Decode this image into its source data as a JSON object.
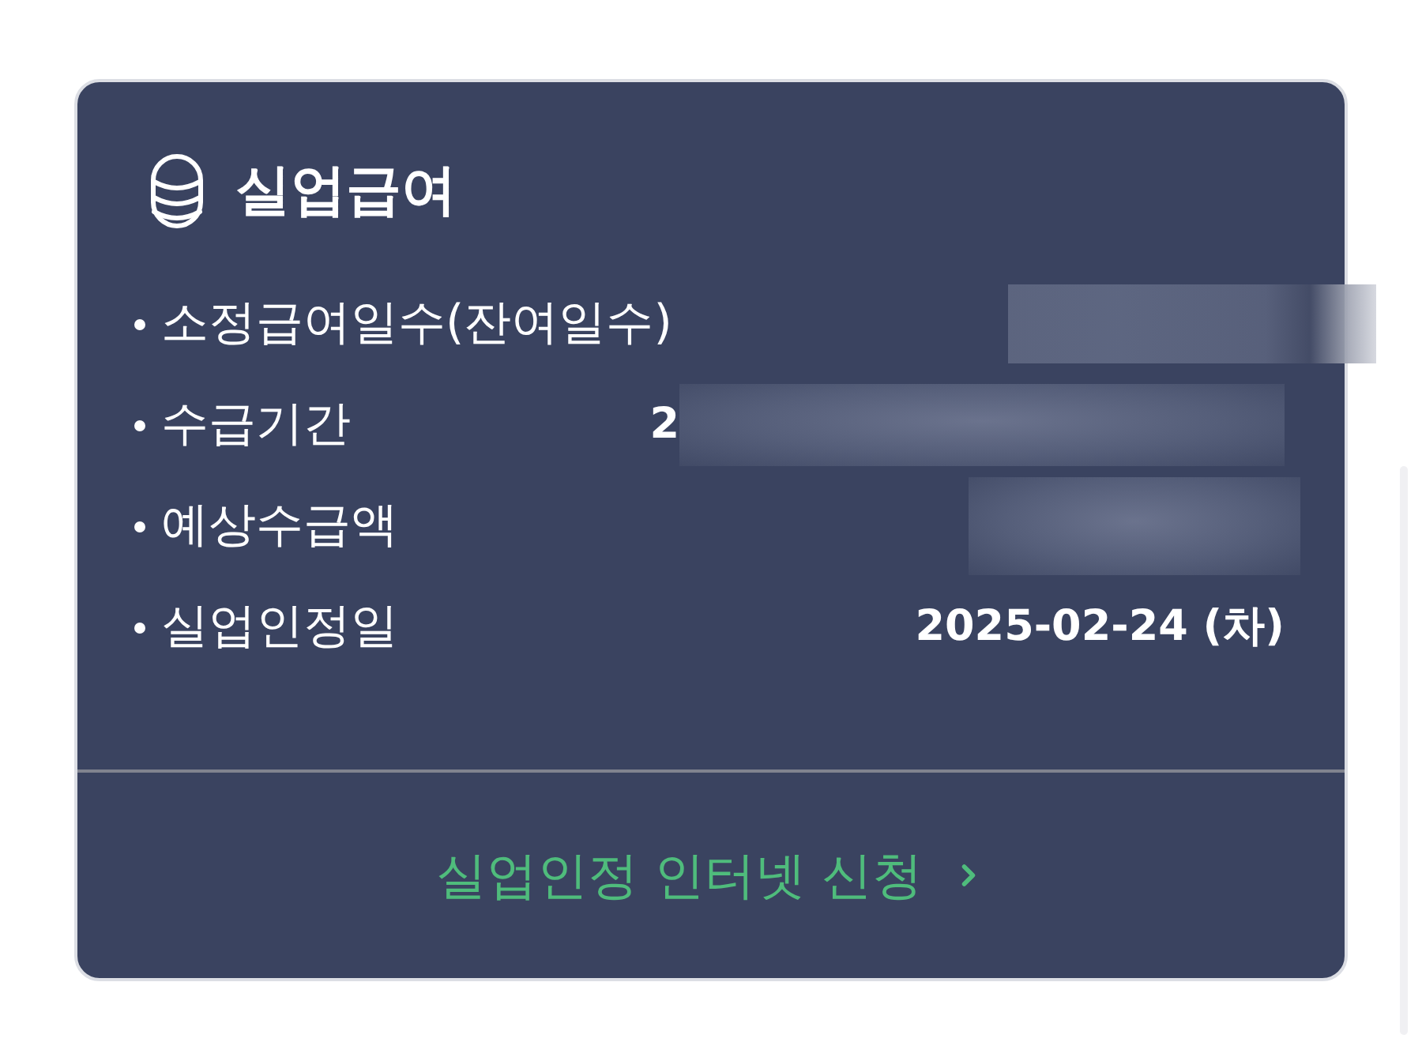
{
  "card": {
    "title": "실업급여",
    "rows": [
      {
        "label": "소정급여일수(잔여일수)",
        "blurred": true
      },
      {
        "label": "수급기간",
        "value": "2",
        "blurred": true
      },
      {
        "label": "예상수급액",
        "blurred": true
      },
      {
        "label": "실업인정일",
        "value": "2025-02-24 (차)",
        "blurred": false
      }
    ],
    "link": {
      "label": "실업인정 인터넷 신청"
    }
  }
}
